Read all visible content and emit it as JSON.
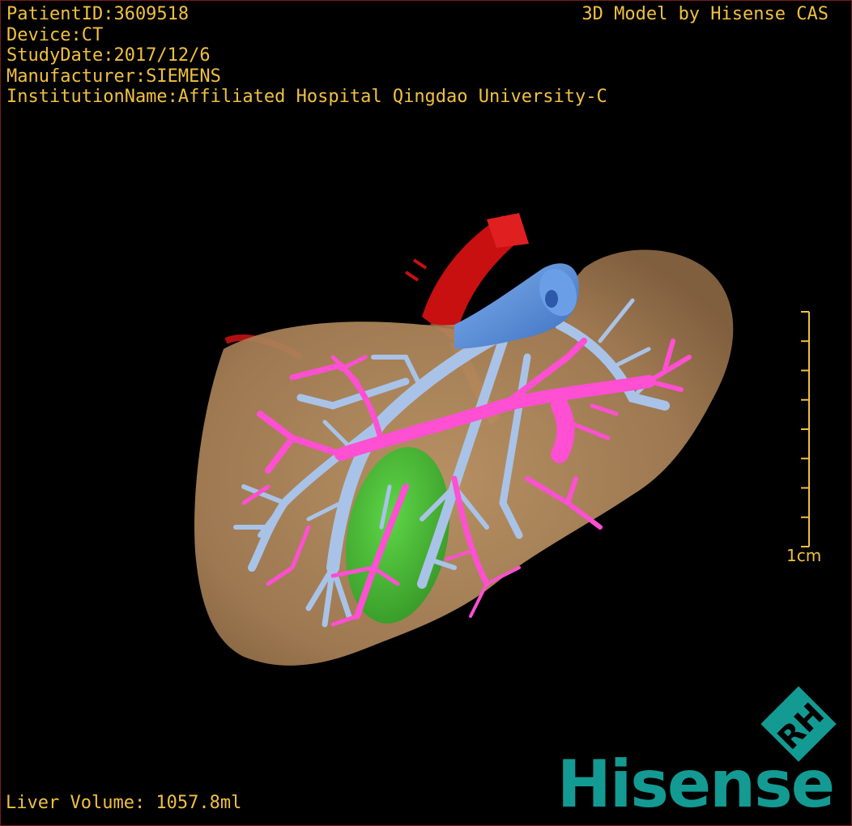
{
  "overlay": {
    "patient_id": "PatientID:3609518",
    "device": "Device:CT",
    "study_date": "StudyDate:2017/12/6",
    "manufacturer": "Manufacturer:SIEMENS",
    "institution": "InstitutionName:Affiliated Hospital Qingdao University-C",
    "credit": "3D Model by Hisense CAS",
    "liver_volume": "Liver Volume: 1057.8ml"
  },
  "scale_bar": {
    "label": "1cm",
    "ticks": 9
  },
  "logo": {
    "mark": "RH",
    "brand": "Hisense"
  },
  "colors": {
    "overlay_text": "#f0c040",
    "liver": "#b08a5c",
    "artery": "#cc1111",
    "vein": "#a9c3e8",
    "vena_cava": "#5b8fd8",
    "portal_vein": "#ff4fd2",
    "gallbladder": "#3cc03c",
    "brand": "#139a93"
  }
}
